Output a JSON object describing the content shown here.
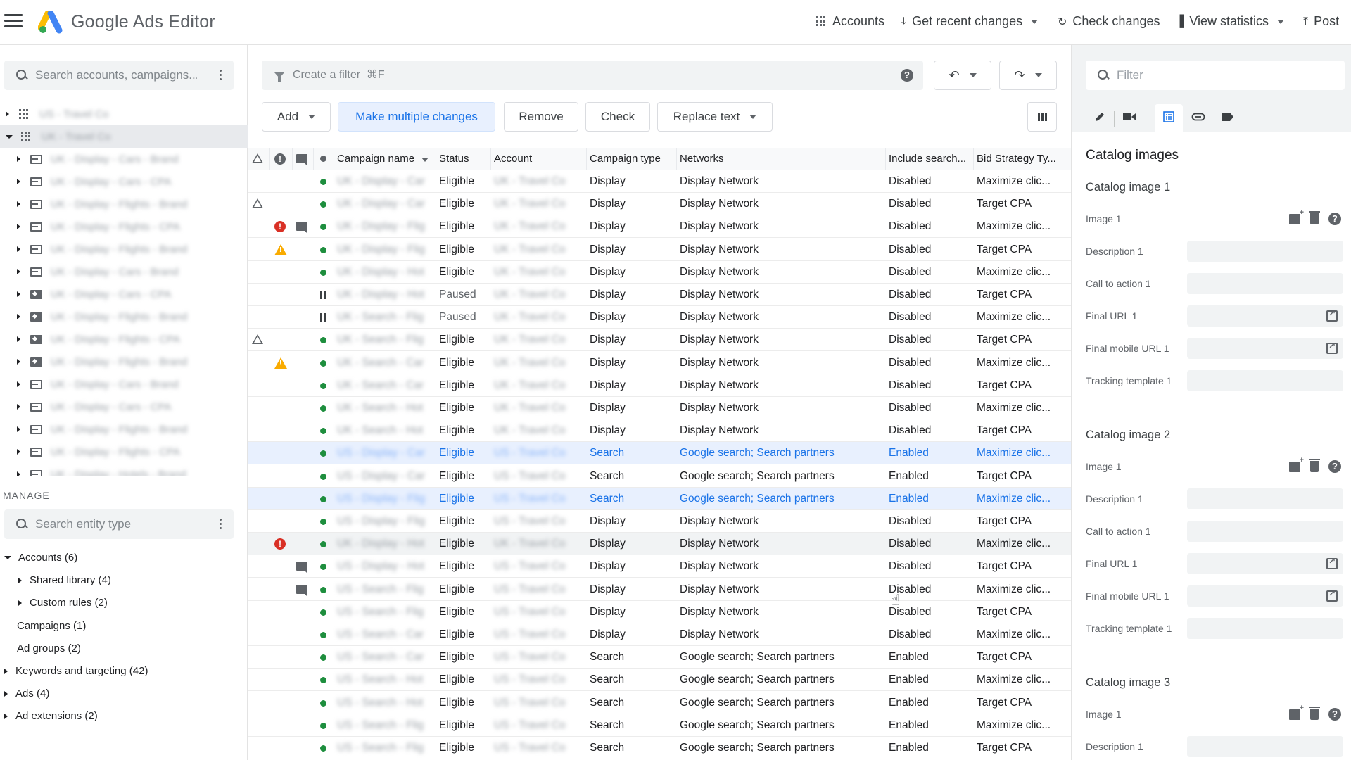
{
  "header": {
    "app_title": "Google Ads Editor",
    "actions": [
      {
        "label": "Accounts",
        "icon": "grid-icon"
      },
      {
        "label": "Get recent changes",
        "icon": "download-icon",
        "dropdown": true
      },
      {
        "label": "Check changes",
        "icon": "refresh-icon"
      },
      {
        "label": "View statistics",
        "icon": "bar-chart-icon",
        "dropdown": true
      },
      {
        "label": "Post",
        "icon": "upload-icon"
      }
    ]
  },
  "left_panel": {
    "search_placeholder": "Search accounts, campaigns...",
    "tree": [
      {
        "type": "account",
        "label": "US - Travel Co",
        "expanded": false
      },
      {
        "type": "account",
        "label": "UK - Travel Co",
        "expanded": true,
        "selected": true
      },
      {
        "type": "campaign",
        "label": "UK - Display - Cars - Brand"
      },
      {
        "type": "campaign",
        "label": "UK - Display - Cars - CPA"
      },
      {
        "type": "campaign",
        "label": "UK - Display - Flights - Brand"
      },
      {
        "type": "campaign",
        "label": "UK - Display - Flights - CPA"
      },
      {
        "type": "campaign",
        "label": "UK - Display - Flights - Brand"
      },
      {
        "type": "campaign",
        "label": "UK - Display - Cars - Brand"
      },
      {
        "type": "shopping",
        "label": "UK - Display - Cars - CPA"
      },
      {
        "type": "shopping",
        "label": "UK - Display - Flights - Brand"
      },
      {
        "type": "shopping",
        "label": "UK - Display - Flights - CPA"
      },
      {
        "type": "shopping",
        "label": "UK - Display - Flights - Brand"
      },
      {
        "type": "campaign",
        "label": "UK - Display - Cars - Brand"
      },
      {
        "type": "campaign",
        "label": "UK - Display - Cars - CPA"
      },
      {
        "type": "campaign",
        "label": "UK - Display - Flights - Brand"
      },
      {
        "type": "campaign",
        "label": "UK - Display - Flights - CPA"
      },
      {
        "type": "campaign",
        "label": "UK - Display - Hotels - Brand"
      }
    ],
    "manage_label": "MANAGE",
    "entity_search_placeholder": "Search entity type",
    "entities": [
      {
        "label": "Accounts (6)",
        "level": 0,
        "toggle": "expanded"
      },
      {
        "label": "Shared library (4)",
        "level": 1,
        "toggle": "collapsed"
      },
      {
        "label": "Custom rules (2)",
        "level": 1,
        "toggle": "collapsed"
      },
      {
        "label": "Campaigns (1)",
        "level": 0,
        "toggle": "none"
      },
      {
        "label": "Ad groups (2)",
        "level": 0,
        "toggle": "none"
      },
      {
        "label": "Keywords and targeting (42)",
        "level": 0,
        "toggle": "collapsed"
      },
      {
        "label": "Ads (4)",
        "level": 0,
        "toggle": "collapsed"
      },
      {
        "label": "Ad extensions (2)",
        "level": 0,
        "toggle": "collapsed"
      }
    ]
  },
  "main": {
    "filter_placeholder": "Create a filter  ⌘F",
    "undo_icon": "undo-icon",
    "redo_icon": "redo-icon",
    "buttons": {
      "add": "Add",
      "make_multiple_changes": "Make multiple changes",
      "remove": "Remove",
      "check": "Check",
      "replace_text": "Replace text"
    },
    "columns": {
      "campaign_name": "Campaign name",
      "status": "Status",
      "account": "Account",
      "campaign_type": "Campaign type",
      "networks": "Networks",
      "include_search": "Include search...",
      "bid_strategy": "Bid Strategy Ty..."
    },
    "rows": [
      {
        "delta": false,
        "error": "",
        "comment": false,
        "state": "active",
        "name": "UK - Display - Car",
        "status": "Eligible",
        "account": "UK - Travel Co",
        "type": "Display",
        "networks": "Display Network",
        "include_search": "Disabled",
        "bid": "Maximize clic..."
      },
      {
        "delta": true,
        "error": "",
        "comment": false,
        "state": "active",
        "name": "UK - Display - Car",
        "status": "Eligible",
        "account": "UK - Travel Co",
        "type": "Display",
        "networks": "Display Network",
        "include_search": "Disabled",
        "bid": "Target CPA"
      },
      {
        "delta": false,
        "error": "error",
        "comment": true,
        "state": "active",
        "name": "UK - Display - Flig",
        "status": "Eligible",
        "account": "UK - Travel Co",
        "type": "Display",
        "networks": "Display Network",
        "include_search": "Disabled",
        "bid": "Maximize clic..."
      },
      {
        "delta": false,
        "error": "warning",
        "comment": false,
        "state": "active",
        "name": "UK - Display - Flig",
        "status": "Eligible",
        "account": "UK - Travel Co",
        "type": "Display",
        "networks": "Display Network",
        "include_search": "Disabled",
        "bid": "Target CPA"
      },
      {
        "delta": false,
        "error": "",
        "comment": false,
        "state": "active",
        "name": "UK - Display - Hot",
        "status": "Eligible",
        "account": "UK - Travel Co",
        "type": "Display",
        "networks": "Display Network",
        "include_search": "Disabled",
        "bid": "Maximize clic..."
      },
      {
        "delta": false,
        "error": "",
        "comment": false,
        "state": "paused",
        "name": "UK - Display - Hot",
        "status": "Paused",
        "account": "UK - Travel Co",
        "type": "Display",
        "networks": "Display Network",
        "include_search": "Disabled",
        "bid": "Target CPA"
      },
      {
        "delta": false,
        "error": "",
        "comment": false,
        "state": "paused",
        "name": "UK - Search - Flig",
        "status": "Paused",
        "account": "UK - Travel Co",
        "type": "Display",
        "networks": "Display Network",
        "include_search": "Disabled",
        "bid": "Maximize clic..."
      },
      {
        "delta": true,
        "error": "",
        "comment": false,
        "state": "active",
        "name": "UK - Search - Flig",
        "status": "Eligible",
        "account": "UK - Travel Co",
        "type": "Display",
        "networks": "Display Network",
        "include_search": "Disabled",
        "bid": "Target CPA"
      },
      {
        "delta": false,
        "error": "warning",
        "comment": false,
        "state": "active",
        "name": "UK - Search - Car",
        "status": "Eligible",
        "account": "UK - Travel Co",
        "type": "Display",
        "networks": "Display Network",
        "include_search": "Disabled",
        "bid": "Maximize clic..."
      },
      {
        "delta": false,
        "error": "",
        "comment": false,
        "state": "active",
        "name": "UK - Search - Car",
        "status": "Eligible",
        "account": "UK - Travel Co",
        "type": "Display",
        "networks": "Display Network",
        "include_search": "Disabled",
        "bid": "Target CPA"
      },
      {
        "delta": false,
        "error": "",
        "comment": false,
        "state": "active",
        "name": "UK - Search - Hot",
        "status": "Eligible",
        "account": "UK - Travel Co",
        "type": "Display",
        "networks": "Display Network",
        "include_search": "Disabled",
        "bid": "Maximize clic..."
      },
      {
        "delta": false,
        "error": "",
        "comment": false,
        "state": "active",
        "name": "UK - Search - Hot",
        "status": "Eligible",
        "account": "UK - Travel Co",
        "type": "Display",
        "networks": "Display Network",
        "include_search": "Disabled",
        "bid": "Target CPA"
      },
      {
        "delta": false,
        "error": "",
        "comment": false,
        "state": "active",
        "selected": true,
        "name": "US - Display - Car",
        "status": "Eligible",
        "account": "US - Travel Co",
        "type": "Search",
        "networks": "Google search; Search partners",
        "include_search": "Enabled",
        "bid": "Maximize clic..."
      },
      {
        "delta": false,
        "error": "",
        "comment": false,
        "state": "active",
        "name": "US - Display - Car",
        "status": "Eligible",
        "account": "US - Travel Co",
        "type": "Search",
        "networks": "Google search; Search partners",
        "include_search": "Enabled",
        "bid": "Target CPA"
      },
      {
        "delta": false,
        "error": "",
        "comment": false,
        "state": "active",
        "selected": true,
        "name": "US - Display - Flig",
        "status": "Eligible",
        "account": "US - Travel Co",
        "type": "Search",
        "networks": "Google search; Search partners",
        "include_search": "Enabled",
        "bid": "Maximize clic..."
      },
      {
        "delta": false,
        "error": "",
        "comment": false,
        "state": "active",
        "name": "US - Display - Flig",
        "status": "Eligible",
        "account": "US - Travel Co",
        "type": "Display",
        "networks": "Display Network",
        "include_search": "Disabled",
        "bid": "Target CPA"
      },
      {
        "delta": false,
        "error": "error",
        "comment": false,
        "state": "active",
        "hover": true,
        "name": "UK - Display - Hot",
        "status": "Eligible",
        "account": "UK - Travel Co",
        "type": "Display",
        "networks": "Display Network",
        "include_search": "Disabled",
        "bid": "Maximize clic..."
      },
      {
        "delta": false,
        "error": "",
        "comment": true,
        "state": "active",
        "name": "US - Display - Hot",
        "status": "Eligible",
        "account": "US - Travel Co",
        "type": "Display",
        "networks": "Display Network",
        "include_search": "Disabled",
        "bid": "Target CPA"
      },
      {
        "delta": false,
        "error": "",
        "comment": true,
        "state": "active",
        "name": "US - Search - Flig",
        "status": "Eligible",
        "account": "US - Travel Co",
        "type": "Display",
        "networks": "Display Network",
        "include_search": "Disabled",
        "bid": "Maximize clic..."
      },
      {
        "delta": false,
        "error": "",
        "comment": false,
        "state": "active",
        "name": "US - Search - Flig",
        "status": "Eligible",
        "account": "US - Travel Co",
        "type": "Display",
        "networks": "Display Network",
        "include_search": "Disabled",
        "bid": "Target CPA"
      },
      {
        "delta": false,
        "error": "",
        "comment": false,
        "state": "active",
        "name": "US - Search - Car",
        "status": "Eligible",
        "account": "US - Travel Co",
        "type": "Display",
        "networks": "Display Network",
        "include_search": "Disabled",
        "bid": "Maximize clic..."
      },
      {
        "delta": false,
        "error": "",
        "comment": false,
        "state": "active",
        "name": "US - Search - Car",
        "status": "Eligible",
        "account": "US - Travel Co",
        "type": "Search",
        "networks": "Google search; Search partners",
        "include_search": "Enabled",
        "bid": "Target CPA"
      },
      {
        "delta": false,
        "error": "",
        "comment": false,
        "state": "active",
        "name": "US - Search - Hot",
        "status": "Eligible",
        "account": "US - Travel Co",
        "type": "Search",
        "networks": "Google search; Search partners",
        "include_search": "Enabled",
        "bid": "Maximize clic..."
      },
      {
        "delta": false,
        "error": "",
        "comment": false,
        "state": "active",
        "name": "US - Search - Hot",
        "status": "Eligible",
        "account": "US - Travel Co",
        "type": "Search",
        "networks": "Google search; Search partners",
        "include_search": "Enabled",
        "bid": "Target CPA"
      },
      {
        "delta": false,
        "error": "",
        "comment": false,
        "state": "active",
        "name": "US - Search - Flig",
        "status": "Eligible",
        "account": "US - Travel Co",
        "type": "Search",
        "networks": "Google search; Search partners",
        "include_search": "Enabled",
        "bid": "Maximize clic..."
      },
      {
        "delta": false,
        "error": "",
        "comment": false,
        "state": "active",
        "name": "US - Search - Flig",
        "status": "Eligible",
        "account": "US - Travel Co",
        "type": "Search",
        "networks": "Google search; Search partners",
        "include_search": "Enabled",
        "bid": "Target CPA"
      }
    ]
  },
  "right_panel": {
    "filter_placeholder": "Filter",
    "tabs": [
      {
        "icon": "pencil-icon"
      },
      {
        "icon": "video-icon"
      },
      {
        "icon": "list-icon",
        "active": true
      },
      {
        "icon": "link-icon"
      },
      {
        "icon": "label-icon"
      }
    ],
    "section_title": "Catalog images",
    "groups": [
      {
        "title": "Catalog image 1",
        "image_label": "Image 1",
        "fields": [
          "Description 1",
          "Call to action 1",
          "Final URL 1",
          "Final mobile URL 1",
          "Tracking template 1"
        ]
      },
      {
        "title": "Catalog image 2",
        "image_label": "Image 1",
        "fields": [
          "Description 1",
          "Call to action 1",
          "Final URL 1",
          "Final mobile URL 1",
          "Tracking template 1"
        ]
      },
      {
        "title": "Catalog image 3",
        "image_label": "Image 1",
        "fields": [
          "Description 1"
        ]
      }
    ]
  },
  "colors": {
    "accent": "#1a73e8",
    "eligible_dot": "#1e8e3e",
    "error": "#d93025",
    "warning": "#f9ab00",
    "selected_row_bg": "#e8f0fe"
  }
}
